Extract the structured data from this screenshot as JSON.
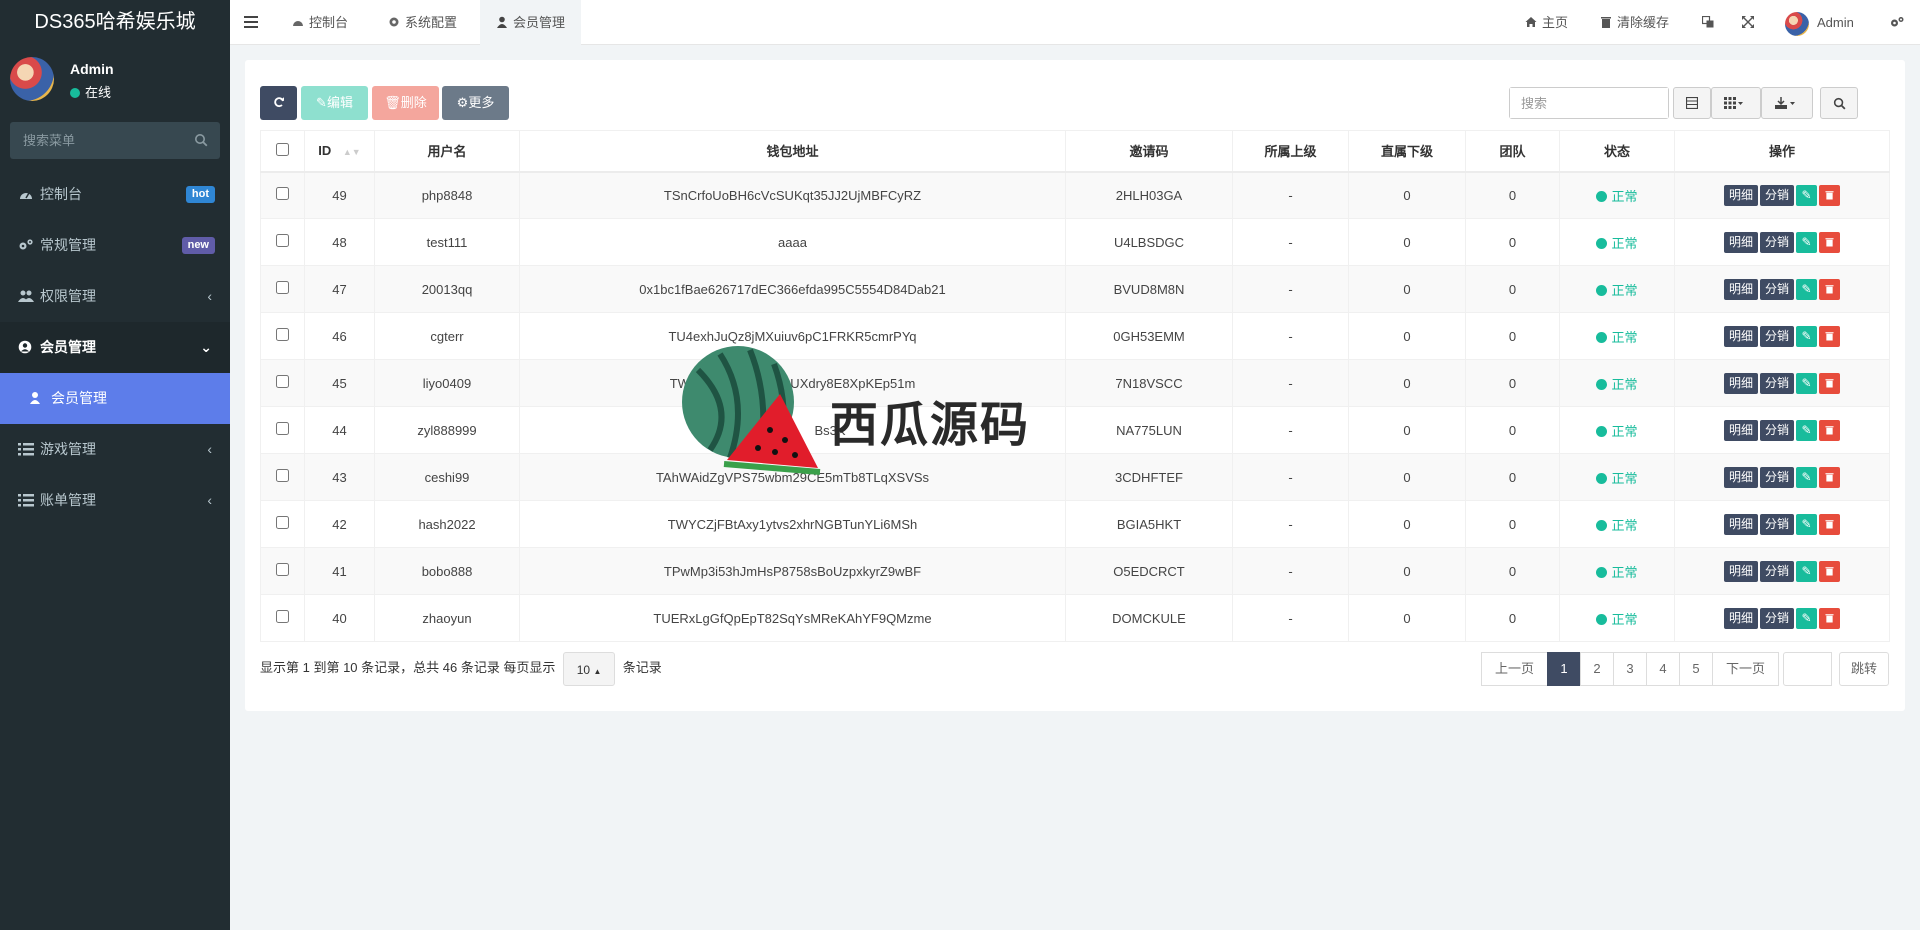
{
  "app": {
    "title": "DS365哈希娱乐城"
  },
  "user": {
    "name": "Admin",
    "status": "在线"
  },
  "sidebar": {
    "search_placeholder": "搜索菜单",
    "items": [
      {
        "label": "控制台",
        "icon": "dashboard-icon",
        "badge": "hot"
      },
      {
        "label": "常规管理",
        "icon": "cogs-icon",
        "badge": "new"
      },
      {
        "label": "权限管理",
        "icon": "group-icon"
      },
      {
        "label": "会员管理",
        "icon": "user-circle-icon"
      },
      {
        "label": "会员管理",
        "icon": "user-icon"
      },
      {
        "label": "游戏管理",
        "icon": "list-icon"
      },
      {
        "label": "账单管理",
        "icon": "list-icon"
      }
    ]
  },
  "header": {
    "tabs": [
      {
        "label": "控制台"
      },
      {
        "label": "系统配置"
      },
      {
        "label": "会员管理"
      }
    ],
    "home": "主页",
    "clear_cache": "清除缓存",
    "admin": "Admin"
  },
  "toolbar": {
    "edit": "编辑",
    "delete": "删除",
    "more": "更多",
    "search_placeholder": "搜索"
  },
  "table": {
    "columns": [
      "ID",
      "用户名",
      "钱包地址",
      "邀请码",
      "所属上级",
      "直属下级",
      "团队",
      "状态",
      "操作"
    ],
    "rows": [
      {
        "id": "49",
        "username": "php8848",
        "wallet": "TSnCrfoUoBH6cVcSUKqt35JJ2UjMBFCyRZ",
        "invite": "2HLH03GA",
        "parent": "-",
        "direct": "0",
        "team": "0",
        "status": "正常"
      },
      {
        "id": "48",
        "username": "test111",
        "wallet": "aaaa",
        "invite": "U4LBSDGC",
        "parent": "-",
        "direct": "0",
        "team": "0",
        "status": "正常"
      },
      {
        "id": "47",
        "username": "20013qq",
        "wallet": "0x1bc1fBae626717dEC366efda995C5554D84Dab21",
        "invite": "BVUD8M8N",
        "parent": "-",
        "direct": "0",
        "team": "0",
        "status": "正常"
      },
      {
        "id": "46",
        "username": "cgterr",
        "wallet": "TU4exhJuQz8jMXuiuv6pC1FRKR5cmrPYq",
        "invite": "0GH53EMM",
        "parent": "-",
        "direct": "0",
        "team": "0",
        "status": "正常"
      },
      {
        "id": "45",
        "username": "liyo0409",
        "wallet": "TWmJr                 qQUXdry8E8XpKEp51m",
        "invite": "7N18VSCC",
        "parent": "-",
        "direct": "0",
        "team": "0",
        "status": "正常"
      },
      {
        "id": "44",
        "username": "zyl888999",
        "wallet": "TBZ              Bs3K",
        "invite": "NA775LUN",
        "parent": "-",
        "direct": "0",
        "team": "0",
        "status": "正常"
      },
      {
        "id": "43",
        "username": "ceshi99",
        "wallet": "TAhWAidZgVPS75wbm29CE5mTb8TLqXSVSs",
        "invite": "3CDHFTEF",
        "parent": "-",
        "direct": "0",
        "team": "0",
        "status": "正常"
      },
      {
        "id": "42",
        "username": "hash2022",
        "wallet": "TWYCZjFBtAxy1ytvs2xhrNGBTunYLi6MSh",
        "invite": "BGIA5HKT",
        "parent": "-",
        "direct": "0",
        "team": "0",
        "status": "正常"
      },
      {
        "id": "41",
        "username": "bobo888",
        "wallet": "TPwMp3i53hJmHsP8758sBoUzpxkyrZ9wBF",
        "invite": "O5EDCRCT",
        "parent": "-",
        "direct": "0",
        "team": "0",
        "status": "正常"
      },
      {
        "id": "40",
        "username": "zhaoyun",
        "wallet": "TUERxLgGfQpEpT82SqYsMReKAhYF9QMzme",
        "invite": "DOMCKULE",
        "parent": "-",
        "direct": "0",
        "team": "0",
        "status": "正常"
      }
    ],
    "actions": {
      "detail": "明细",
      "distribution": "分销"
    }
  },
  "footer": {
    "info_prefix": "显示第 1 到第 10 条记录，总共 46 条记录 每页显示",
    "page_size": "10",
    "info_suffix": "条记录"
  },
  "pagination": {
    "prev": "上一页",
    "pages": [
      "1",
      "2",
      "3",
      "4",
      "5"
    ],
    "next": "下一页",
    "jump": "跳转"
  },
  "watermark": {
    "text": "西瓜源码"
  },
  "colors": {
    "sidebar": "#222d32",
    "accent": "#5d7dea",
    "success": "#18bc9c",
    "danger": "#e74c3c",
    "dark": "#3f4b63"
  }
}
